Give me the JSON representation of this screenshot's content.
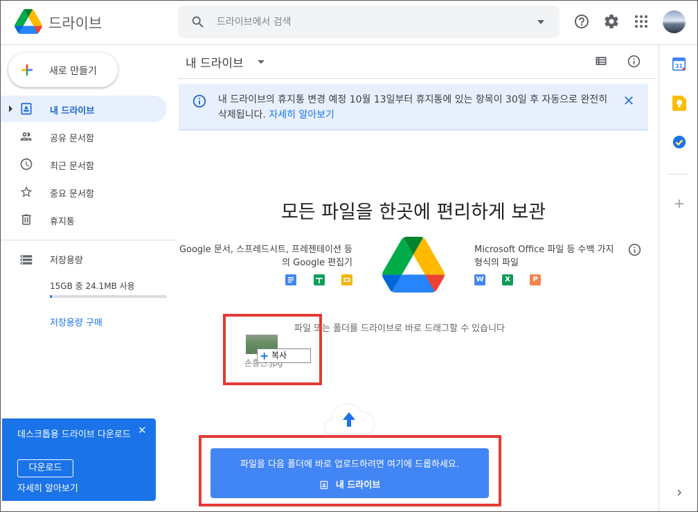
{
  "header": {
    "app_name": "드라이브",
    "search_placeholder": "드라이브에서 검색",
    "icons": [
      "help-icon",
      "settings-icon",
      "apps-icon",
      "avatar"
    ]
  },
  "sidebar": {
    "new_label": "새로 만들기",
    "items": [
      {
        "label": "내 드라이브",
        "icon": "my-drive-icon",
        "active": true
      },
      {
        "label": "공유 문서함",
        "icon": "shared-icon",
        "active": false
      },
      {
        "label": "최근 문서함",
        "icon": "recent-icon",
        "active": false
      },
      {
        "label": "중요 문서함",
        "icon": "star-icon",
        "active": false
      },
      {
        "label": "휴지통",
        "icon": "trash-icon",
        "active": false
      }
    ],
    "storage": {
      "label": "저장용량",
      "used_text": "15GB 중 24.1MB 사용",
      "used_fraction": 0.0016,
      "buy_label": "저장용량 구매"
    },
    "promo": {
      "title": "데스크톱용 드라이브 다운로드",
      "close": "✕",
      "download_label": "다운로드",
      "learn_label": "자세히 알아보기"
    }
  },
  "main": {
    "title": "내 드라이브",
    "notice": {
      "text": "내 드라이브의 휴지통 변경 예정 10월 13일부터 휴지통에 있는 항목이 30일 후 자동으로 완전히 삭제됩니다.",
      "link": "자세히 알아보기"
    },
    "hero_title": "모든 파일을 한곳에 편리하게 보관",
    "left_desc": "Google 문서, 스프레드시트, 프레젠테이션 등의 Google 편집기",
    "right_desc": "Microsoft Office 파일 등 수백 가지 형식의 파일",
    "office_icons": [
      "W",
      "X",
      "P"
    ],
    "drag_hint": "파일 또는 폴더를 드라이브로 바로 드래그할 수 있습니다",
    "drag_file_name": "손흥민.jpg",
    "copy_label": "복사",
    "upload_text": "파일을 다음 폴더에 바로 업로드하려면 여기에 드롭하세요.",
    "upload_target": "내 드라이브"
  },
  "colors": {
    "accent": "#1a73e8",
    "drop_zone": "#4285f4",
    "highlight_box": "#e53935",
    "notice_bg": "#e8f0fe"
  }
}
